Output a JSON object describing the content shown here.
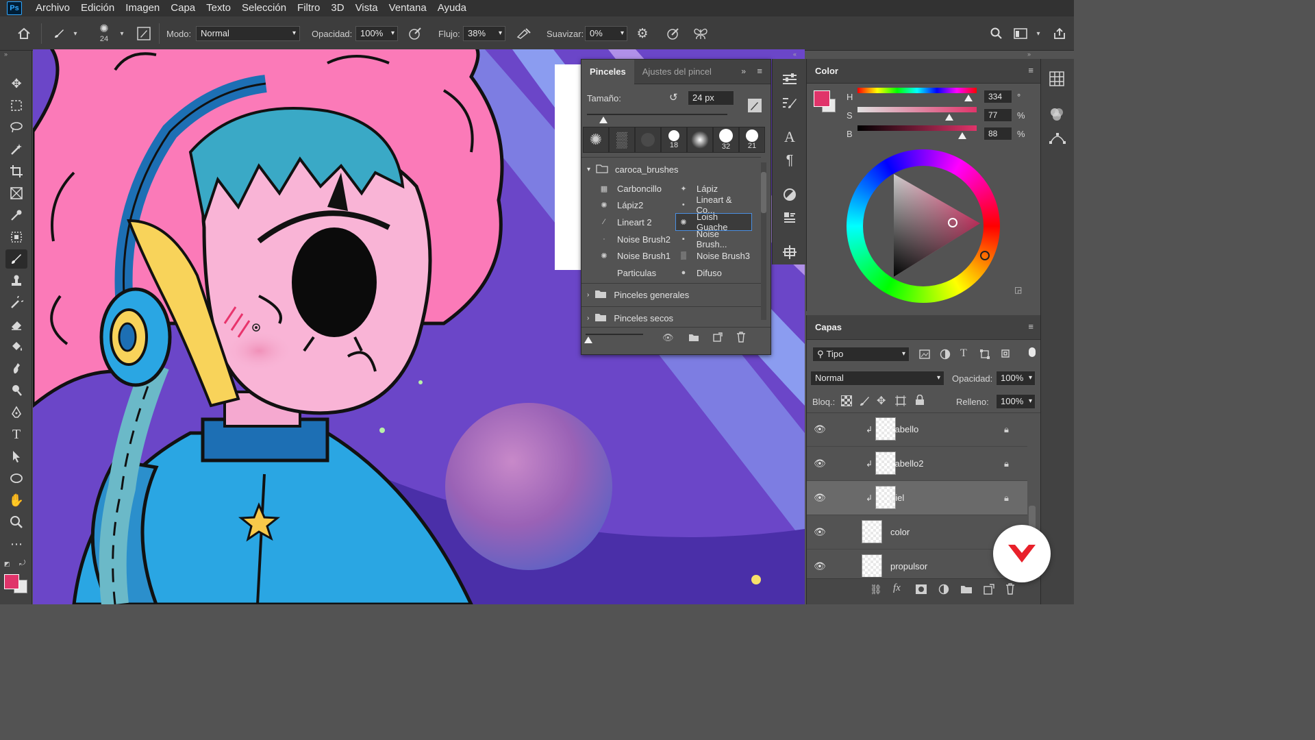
{
  "app": {
    "logo": "Ps",
    "menu": [
      "Archivo",
      "Edición",
      "Imagen",
      "Capa",
      "Texto",
      "Selección",
      "Filtro",
      "3D",
      "Vista",
      "Ventana",
      "Ayuda"
    ]
  },
  "options": {
    "brush_size": "24",
    "mode_label": "Modo:",
    "mode_value": "Normal",
    "opacity_label": "Opacidad:",
    "opacity_value": "100%",
    "flow_label": "Flujo:",
    "flow_value": "38%",
    "smooth_label": "Suavizar:",
    "smooth_value": "0%"
  },
  "brushes_panel": {
    "tab_brushes": "Pinceles",
    "tab_settings": "Ajustes del pincel",
    "size_label": "Tamaño:",
    "size_value": "24 px",
    "presets": [
      "18",
      "32",
      "21"
    ],
    "folder": "caroca_brushes",
    "items_left": [
      "Carboncillo",
      "Lápiz2",
      "Lineart 2",
      "Noise Brush2",
      "Noise Brush1",
      "Particulas"
    ],
    "items_right": [
      "Lápiz",
      "Lineart & Co...",
      "Loish Guache",
      "Noise Brush...",
      "Noise Brush3",
      "Difuso"
    ],
    "folders": [
      "Pinceles generales",
      "Pinceles secos"
    ]
  },
  "color_panel": {
    "title": "Color",
    "h_label": "H",
    "h_value": "334",
    "h_unit": "°",
    "s_label": "S",
    "s_value": "77",
    "s_unit": "%",
    "b_label": "B",
    "b_value": "88",
    "b_unit": "%",
    "foreground": "#e0346a",
    "h_level": 0.93,
    "s_level": 0.77,
    "b_level": 0.88
  },
  "layers_panel": {
    "title": "Capas",
    "filter_value": "Tipo",
    "blend_value": "Normal",
    "opacity_label": "Opacidad:",
    "opacity_value": "100%",
    "lock_label": "Bloq.:",
    "fill_label": "Relleno:",
    "fill_value": "100%",
    "layers": [
      {
        "name": "cabello",
        "clipped": true,
        "locked": true,
        "active": false
      },
      {
        "name": "cabello2",
        "clipped": true,
        "locked": true,
        "active": false
      },
      {
        "name": "piel",
        "clipped": true,
        "locked": true,
        "active": true
      },
      {
        "name": "color",
        "clipped": false,
        "locked": true,
        "active": false
      },
      {
        "name": "propulsor",
        "clipped": false,
        "locked": false,
        "active": false
      }
    ]
  }
}
